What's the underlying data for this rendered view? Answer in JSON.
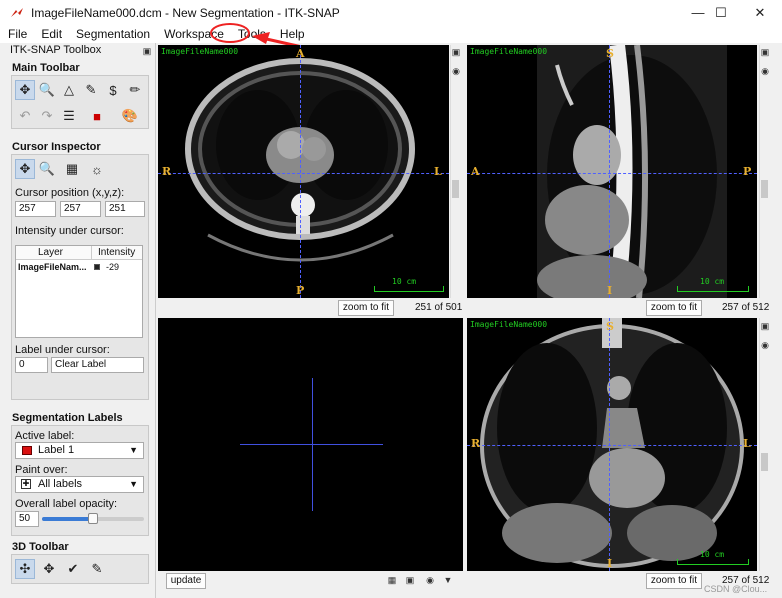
{
  "window": {
    "title": "ImageFileName000.dcm - New Segmentation - ITK-SNAP",
    "min_icon": "minimize-icon",
    "max_icon": "maximize-icon",
    "close_icon": "close-icon"
  },
  "menu": {
    "items": [
      "File",
      "Edit",
      "Segmentation",
      "Workspace",
      "Tools",
      "Help"
    ]
  },
  "toolbox": {
    "title": "ITK-SNAP Toolbox",
    "main_toolbar": "Main Toolbar",
    "cursor_inspector": "Cursor Inspector",
    "cursor_position_label": "Cursor position (x,y,z):",
    "cursor_x": "257",
    "cursor_y": "257",
    "cursor_z": "251",
    "intensity_label": "Intensity under cursor:",
    "table_headers": [
      "Layer",
      "Intensity"
    ],
    "table_rows": [
      {
        "layer": "ImageFileNam...",
        "intensity": "-29"
      }
    ],
    "label_under_cursor_label": "Label under cursor:",
    "label_under_cursor_id": "0",
    "label_under_cursor_name": "Clear Label",
    "segmentation_labels": "Segmentation Labels",
    "active_label_label": "Active label:",
    "active_label": "Label 1",
    "active_label_color": "#d91010",
    "paint_over_label": "Paint over:",
    "paint_over": "All labels",
    "opacity_label": "Overall label opacity:",
    "opacity_value": "50",
    "opacity_fraction": 0.5,
    "toolbar_3d": "3D Toolbar"
  },
  "views": {
    "axial": {
      "image_name": "ImageFileName000",
      "left": "R",
      "right": "L",
      "top": "A",
      "bottom": "P",
      "scale": "10 cm",
      "zoom": "zoom to fit",
      "slice": "251 of 501"
    },
    "sagittal": {
      "image_name": "ImageFileName000",
      "left": "A",
      "right": "P",
      "top": "S",
      "bottom": "I",
      "scale": "10 cm",
      "zoom": "zoom to fit",
      "slice": "257 of 512"
    },
    "coronal": {
      "image_name": "ImageFileName000",
      "left": "R",
      "right": "L",
      "top": "S",
      "bottom": "I",
      "scale": "10 cm",
      "zoom": "zoom to fit",
      "slice": "257 of 512"
    },
    "render3d": {
      "update": "update"
    }
  },
  "watermark": "CSDN @Clou..."
}
